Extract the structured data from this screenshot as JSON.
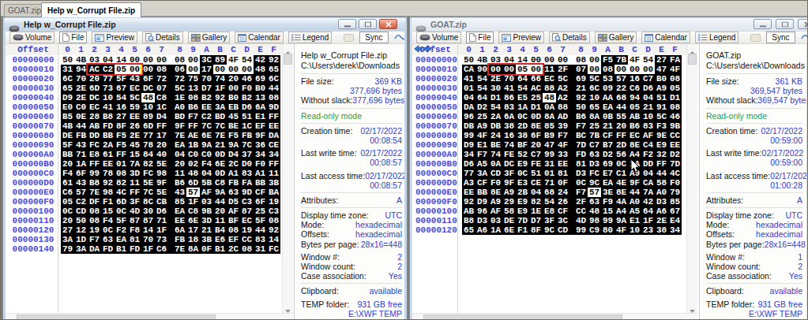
{
  "app": {
    "tabs": [
      {
        "label": "GOAT.zip",
        "active": false
      },
      {
        "label": "Help w_Corrupt File.zip",
        "active": true
      }
    ]
  },
  "toolbar": {
    "buttons": [
      {
        "id": "volume",
        "label": "Volume",
        "pressed": false
      },
      {
        "id": "file",
        "label": "File",
        "pressed": true
      },
      {
        "id": "preview",
        "label": "Preview",
        "pressed": false
      },
      {
        "id": "details",
        "label": "Details",
        "pressed": false
      },
      {
        "id": "gallery",
        "label": "Gallery",
        "pressed": false
      },
      {
        "id": "calendar",
        "label": "Calendar",
        "pressed": false
      },
      {
        "id": "legend",
        "label": "Legend",
        "pressed": false
      }
    ],
    "sync_label": "Sync"
  },
  "hex_header": {
    "offset_label": "Offset",
    "columns": [
      "0",
      "1",
      "2",
      "3",
      "4",
      "5",
      "6",
      "7",
      "8",
      "9",
      "A",
      "B",
      "C",
      "D",
      "E",
      "F"
    ]
  },
  "colors": {
    "diff_highlight": "#000000",
    "selection_box": "#d3262a",
    "caret": "#ffe800",
    "offset_text": "#4b4be0",
    "value_text": "#3340cc",
    "readonly_green": "#1ea03c"
  },
  "left_window": {
    "title": "Help w_Corrupt File.zip",
    "offsets": [
      "00000000",
      "00000010",
      "00000020",
      "00000030",
      "00000040",
      "00000050",
      "00000060",
      "00000070",
      "00000080",
      "00000090",
      "000000A0",
      "000000B0",
      "000000C0",
      "000000D0",
      "000000E0",
      "000000F0",
      "00000100",
      "00000110",
      "00000120",
      "00000130",
      "00000140"
    ],
    "rows": [
      "50 4B 03 04 14 00 00 00 08 00 3C 89 4F 54 42 92",
      "31 94 AC C2 05 00 00 08 06 00 17 00 00 00 48 65",
      "6C 70 20 77 5F 43 6F 72 72 75 70 74 20 46 69 6C",
      "65 2E 6D 73 67 EC DC 07 5C 13 D7 1F 00 F0 B0 44",
      "D9 2E DC 10 54 5C 48 C8 1E 08 B2 92 B0 B2 13 08",
      "E0 C0 EC 41 16 59 10 1C A0 B6 EE 3A EB D6 6A 9D",
      "B5 0E 28 B8 27 EE 89 D4 BD F7 C2 BD 45 51 E1 FF",
      "4B 44 AB FD 8F 26 6D FF 9F FF 7C 7C BE 1C EF EE",
      "DE FB DD BB F5 2E 77 17 7E AE 6E 7E F5 FB 9F DA",
      "5F 43 FC 2A F5 45 78 20 EA 1B 9A 21 9A 7C 36 CE",
      "BB 71 E8 61 FF 15 84 40 04 C0 C0 0D D4 37 34 34",
      "20 1A FF EE 01 7A 82 5E 20 02 F4 6E 2C D0 F0 FF",
      "F4 6F 99 78 08 3D FC 98 11 48 04 0D A1 83 A1 11",
      "61 43 B8 92 82 11 5E 9F B6 6D 5B C8 FB FA BB 3B",
      "C6 57 7E 98 4C FF 7C 5E 43 57 AF 9A 63 9D CF BA",
      "05 C2 DF F1 6D 3F 8C CB 85 1F 03 44 D5 C3 6F 19",
      "0C CD 08 15 0C 4D 30 D6 EA C8 9B 20 AF 87 25 C3",
      "20 50 08 F4 5F 87 87 71 EE 6E 3D 11 BF EC 5F 08",
      "27 12 19 0C F2 F8 14 1F 6A 17 21 B4 08 19 44 92",
      "3A 1D F7 63 EA 81 70 73 FB 18 3B E6 EF CC 83 14",
      "79 3A DA FD B1 FD 1F C6 7E 8A 0F B1 2C 08 31 FC"
    ],
    "selection_box": {
      "row": 1,
      "col_start": 2,
      "col_end": 5
    },
    "caret": {
      "row": 1,
      "col": 6
    },
    "details": [
      {
        "t": "head",
        "l1": "Help w_Corrupt File.zip",
        "l2": "C:\\Users\\derek\\Downloads"
      },
      {
        "t": "sep"
      },
      {
        "l": "File size:",
        "v": "369 KB"
      },
      {
        "l": "",
        "v": "377,696 bytes"
      },
      {
        "l": "Without slack:",
        "v": "377,696 bytes"
      },
      {
        "t": "sep"
      },
      {
        "t": "status",
        "text": "Read-only mode"
      },
      {
        "t": "sep"
      },
      {
        "l": "Creation time:",
        "v": "02/17/2022"
      },
      {
        "l": "",
        "v": "00:08:54"
      },
      {
        "t": "gap"
      },
      {
        "l": "Last write time:",
        "v": "02/17/2022"
      },
      {
        "l": "",
        "v": "00:08:57"
      },
      {
        "t": "gap"
      },
      {
        "l": "Last access time:",
        "v": "02/17/2022"
      },
      {
        "l": "",
        "v": "00:08:57"
      },
      {
        "t": "sep"
      },
      {
        "l": "Attributes:",
        "v": "A"
      },
      {
        "t": "sep"
      },
      {
        "l": "Display time zone:",
        "v": "UTC"
      },
      {
        "l": "Mode:",
        "v": "hexadecimal"
      },
      {
        "l": "Offsets:",
        "v": "hexadecimal"
      },
      {
        "l": "Bytes per page:",
        "v": "28x16=448"
      },
      {
        "t": "gap"
      },
      {
        "l": "Window #:",
        "v": "2"
      },
      {
        "l": "Window count:",
        "v": "2"
      },
      {
        "l": "Case association:",
        "v": "Yes"
      },
      {
        "t": "sep"
      },
      {
        "l": "Clipboard:",
        "v": "available"
      },
      {
        "t": "gap"
      },
      {
        "l": "TEMP folder:",
        "v": "931 GB free"
      },
      {
        "l": "",
        "v": "E:\\XWF TEMP"
      }
    ]
  },
  "right_window": {
    "title": "GOAT.zip",
    "offsets": [
      "00000000",
      "00000010",
      "00000020",
      "00000030",
      "00000040",
      "00000050",
      "00000060",
      "00000070",
      "00000080",
      "00000090",
      "000000A0",
      "000000B0",
      "000000C0",
      "000000D0",
      "000000E0",
      "000000F0",
      "00000100",
      "00000110",
      "00000120"
    ],
    "rows": [
      "50 4B 03 04 14 00 00 00 08 00 F5 7B 4F 54 27 FA",
      "CA 90 00 00 05 00 11 2F 07 00 08 00 00 00 47 4F",
      "41 54 2E 70 64 66 EC 5C 69 5C 53 57 16 C7 B0 08",
      "01 54 30 41 54 AC 88 A2 21 6C 09 22 C6 D6 A9 05",
      "04 64 D1 86 E5 25 48 A2 92 10 AA 68 94 04 51 D1",
      "DA D2 54 83 1A D1 0A 88 50 65 EA 44 05 21 91 08",
      "96 25 2A 6A 0C 0D 8A AD B6 8A 0B 55 AB 10 5C 46",
      "DB A9 DB 38 2D 8E 85 39 F7 25 21 20 B6 83 F3 9B",
      "99 4F 24 16 38 6F B9 F7 BC 7B CF FF EC AF 9E CC",
      "D9 E1 BE 74 BF 20 47 4F 7D C7 B7 2D 8E C4 E9 EE",
      "34 F7 74 FE 52 C7 99 33 FD 63 D2 56 A4 F2 32 D2",
      "D6 A5 0A DC E9 FE 31 EE 81 D3 69 0C 1A DD FF 7D",
      "77 3A CD 3F 0C 51 01 81 D3 FC E7 C1 A9 04 44 4C",
      "A3 CF F0 9F E3 CE 71 0F 0C 9C EA 4E 9F CA 58 F0",
      "EE BB 8E A9 2B 04 68 24 F7 57 3E 8E 44 7A A0 79",
      "92 D9 A9 29 E9 82 54 26 2F 63 F9 4A A0 42 D3 85",
      "AB 96 AF 58 E9 1E E8 CF CC 48 15 A4 A5 64 A6 67",
      "B8 D3 03 DE 7D D7 3F 3C 4D 98 99 9A E1 1F 2E E4",
      "65 A6 1A 6E F1 8F 9C CD 99 C9 80 4F 10 23 38 34"
    ],
    "selection_box": {
      "row": 1,
      "col_start": 2,
      "col_end": 5
    },
    "details": [
      {
        "t": "head",
        "l1": "GOAT.zip",
        "l2": "C:\\Users\\derek\\Downloads"
      },
      {
        "t": "sep"
      },
      {
        "l": "File size:",
        "v": "361 KB"
      },
      {
        "l": "",
        "v": "369,547 bytes"
      },
      {
        "l": "Without slack:",
        "v": "369,547 bytes"
      },
      {
        "t": "sep"
      },
      {
        "t": "status",
        "text": "Read-only mode"
      },
      {
        "t": "sep"
      },
      {
        "l": "Creation time:",
        "v": "02/17/2022"
      },
      {
        "l": "",
        "v": "00:59:00"
      },
      {
        "t": "gap"
      },
      {
        "l": "Last write time:",
        "v": "02/17/2022"
      },
      {
        "l": "",
        "v": "00:59:00"
      },
      {
        "t": "gap"
      },
      {
        "l": "Last access time:",
        "v": "02/17/2022"
      },
      {
        "l": "",
        "v": "01:00:28"
      },
      {
        "t": "sep"
      },
      {
        "l": "Attributes:",
        "v": "A"
      },
      {
        "t": "sep"
      },
      {
        "l": "Display time zone:",
        "v": "UTC"
      },
      {
        "l": "Mode:",
        "v": "hexadecimal"
      },
      {
        "l": "Offsets:",
        "v": "hexadecimal"
      },
      {
        "l": "Bytes per page:",
        "v": "28x16=448"
      },
      {
        "t": "gap"
      },
      {
        "l": "Window #:",
        "v": "1"
      },
      {
        "l": "Window count:",
        "v": "2"
      },
      {
        "l": "Case association:",
        "v": "Yes"
      },
      {
        "t": "sep"
      },
      {
        "l": "Clipboard:",
        "v": "available"
      },
      {
        "t": "gap"
      },
      {
        "l": "TEMP folder:",
        "v": "931 GB free"
      },
      {
        "l": "",
        "v": "E:\\XWF TEMP"
      }
    ]
  }
}
